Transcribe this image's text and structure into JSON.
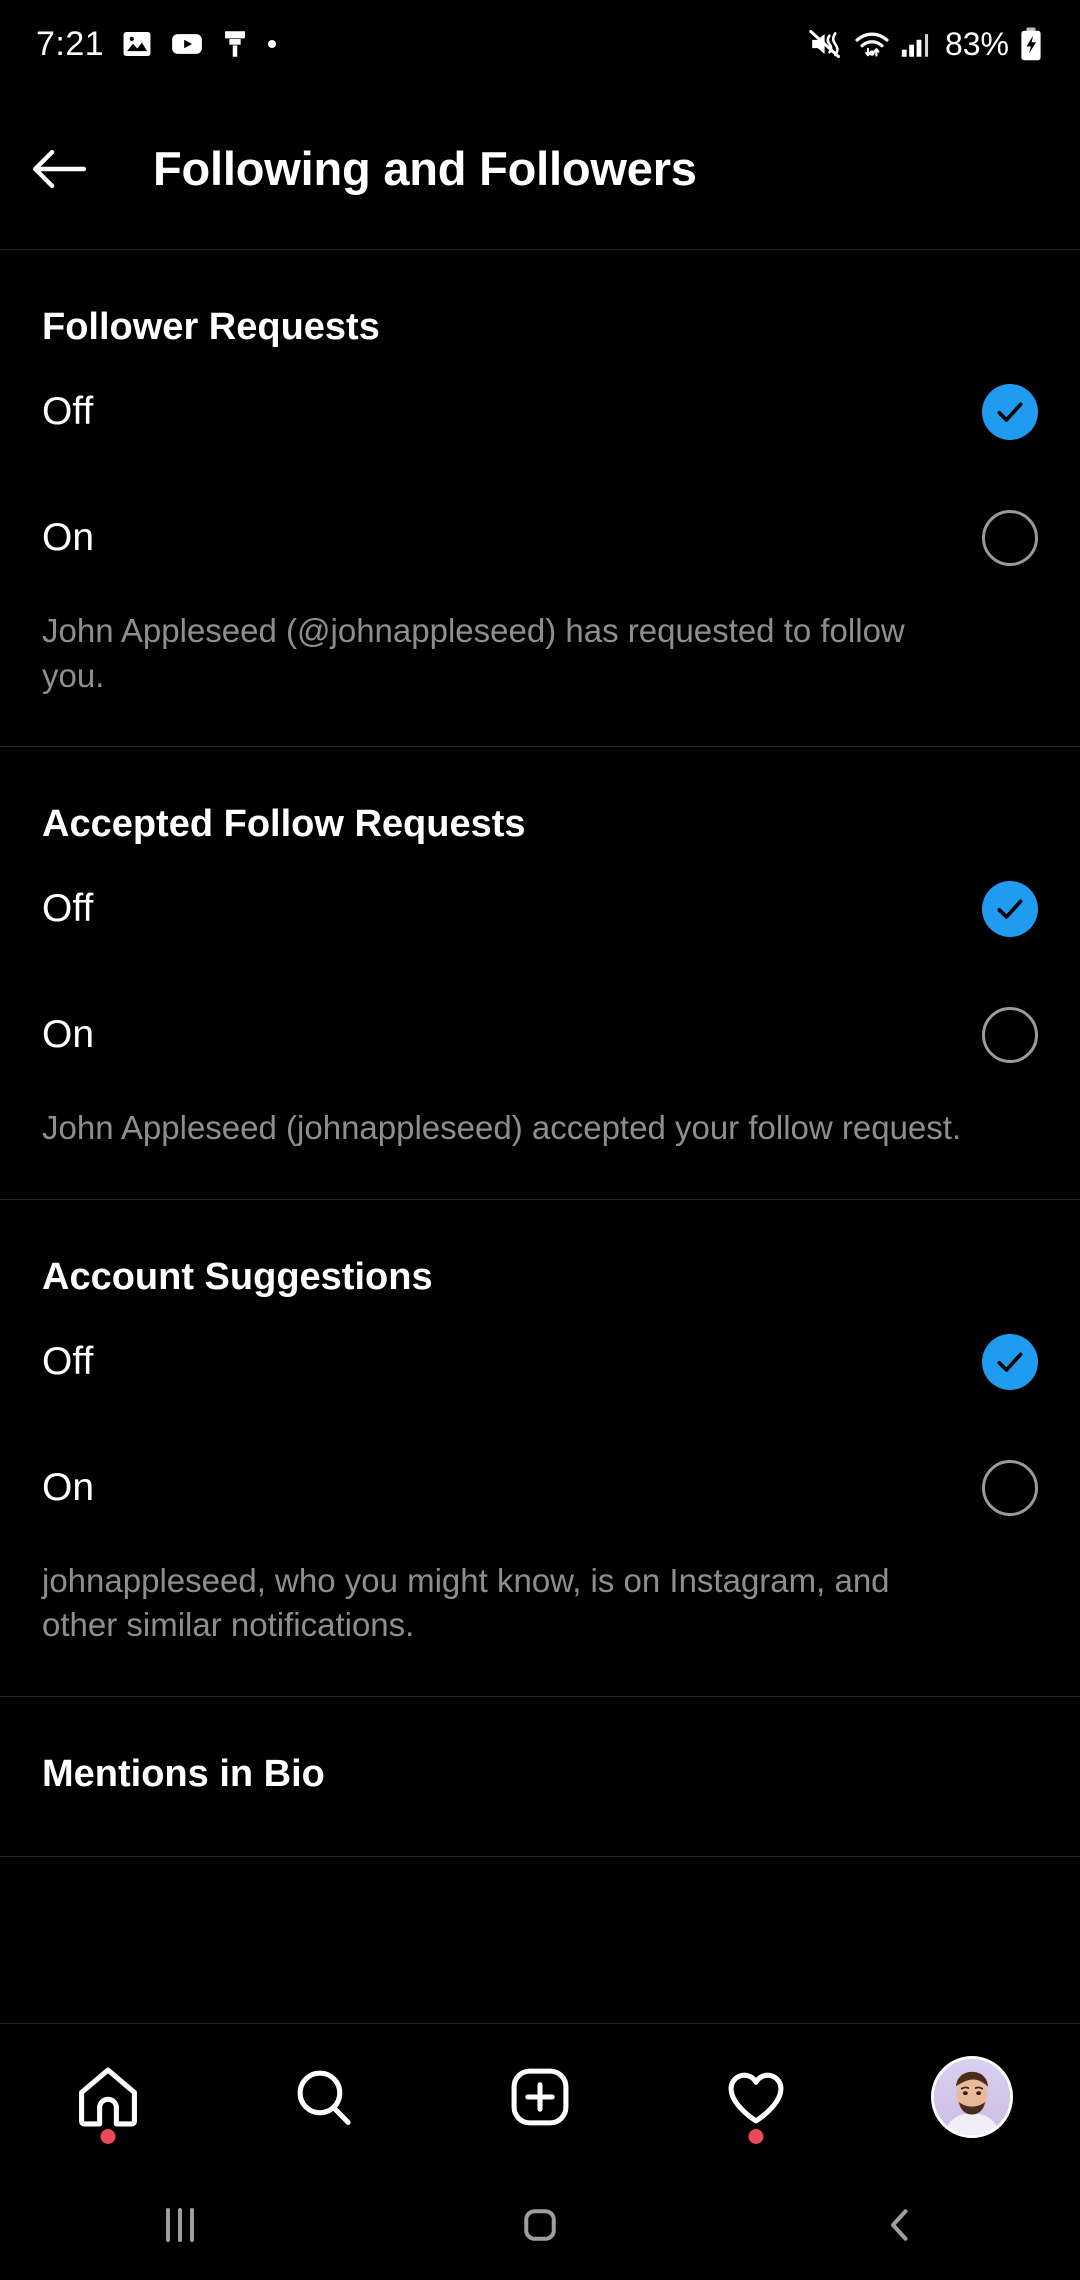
{
  "status_bar": {
    "time": "7:21",
    "left_icons": [
      "gallery-icon",
      "youtube-icon",
      "paintbrush-icon",
      "dot-icon"
    ],
    "right_icons": [
      "vibrate-mute-icon",
      "wifi-icon",
      "cellular-signal-icon"
    ],
    "battery_percent": "83%",
    "battery_state": "charging"
  },
  "header": {
    "back_icon": "arrow-left-icon",
    "title": "Following and Followers"
  },
  "sections": [
    {
      "title": "Follower Requests",
      "options": [
        {
          "label": "Off",
          "selected": true
        },
        {
          "label": "On",
          "selected": false
        }
      ],
      "description": "John Appleseed (@johnappleseed) has requested to follow you."
    },
    {
      "title": "Accepted Follow Requests",
      "options": [
        {
          "label": "Off",
          "selected": true
        },
        {
          "label": "On",
          "selected": false
        }
      ],
      "description": "John Appleseed (johnappleseed) accepted your follow request."
    },
    {
      "title": "Account Suggestions",
      "options": [
        {
          "label": "Off",
          "selected": true
        },
        {
          "label": "On",
          "selected": false
        }
      ],
      "description": "johnappleseed, who you might know, is on Instagram, and other similar notifications."
    },
    {
      "title": "Mentions in Bio",
      "options": [],
      "description": ""
    }
  ],
  "bottom_nav": [
    {
      "name": "home-icon",
      "badge": true
    },
    {
      "name": "search-icon",
      "badge": false
    },
    {
      "name": "create-post-icon",
      "badge": false
    },
    {
      "name": "activity-heart-icon",
      "badge": true
    },
    {
      "name": "profile-avatar",
      "badge": false
    }
  ],
  "android_nav": [
    "recents-icon",
    "home-icon",
    "back-icon"
  ],
  "colors": {
    "background": "#000000",
    "accent_blue": "#1F9BF0",
    "badge_red": "#ED4956",
    "secondary_text": "#8E8E8E",
    "divider": "#262626"
  }
}
